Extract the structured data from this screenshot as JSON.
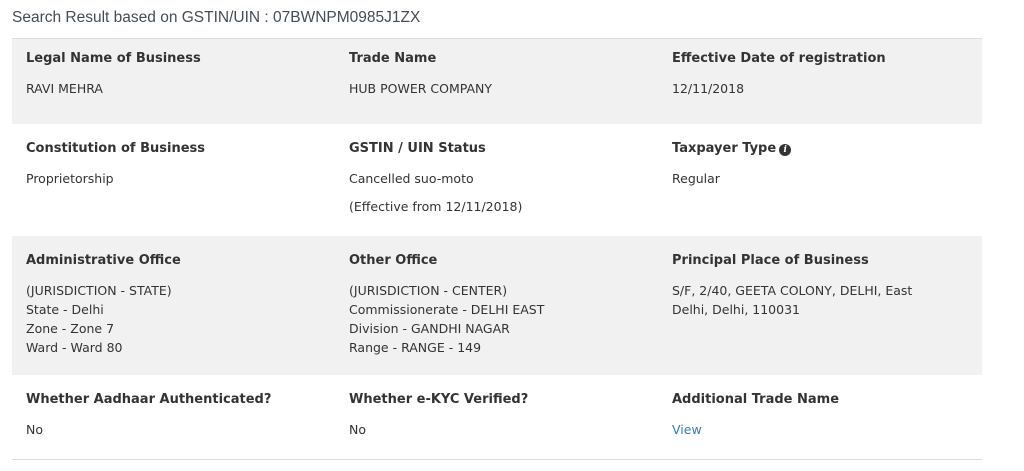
{
  "header": {
    "title": "Search Result based on GSTIN/UIN : 07BWNPM0985J1ZX"
  },
  "rows": [
    {
      "cells": [
        {
          "label": "Legal Name of Business",
          "lines": [
            "RAVI MEHRA"
          ]
        },
        {
          "label": "Trade Name",
          "lines": [
            "HUB POWER COMPANY"
          ]
        },
        {
          "label": "Effective Date of registration",
          "lines": [
            "12/11/2018"
          ]
        }
      ]
    },
    {
      "cells": [
        {
          "label": "Constitution of Business",
          "lines": [
            "Proprietorship"
          ]
        },
        {
          "label": "GSTIN / UIN Status",
          "lines": [
            "Cancelled suo-moto",
            "(Effective from 12/11/2018)"
          ]
        },
        {
          "label": "Taxpayer Type",
          "lines": [
            "Regular"
          ],
          "icon": "info-circle-icon"
        }
      ]
    },
    {
      "cells": [
        {
          "label": "Administrative Office",
          "lines": [
            "(JURISDICTION - STATE)",
            "State - Delhi",
            "Zone - Zone 7",
            "Ward - Ward 80"
          ]
        },
        {
          "label": "Other Office",
          "lines": [
            "(JURISDICTION - CENTER)",
            "Commissionerate - DELHI EAST",
            "Division - GANDHI NAGAR",
            "Range - RANGE - 149"
          ]
        },
        {
          "label": "Principal Place of Business",
          "lines": [
            "S/F, 2/40, GEETA COLONY, DELHI, East",
            "Delhi, Delhi, 110031"
          ]
        }
      ]
    },
    {
      "cells": [
        {
          "label": "Whether Aadhaar Authenticated?",
          "lines": [
            "No"
          ]
        },
        {
          "label": "Whether e-KYC Verified?",
          "lines": [
            "No"
          ]
        },
        {
          "label": "Additional Trade Name",
          "link": "View"
        }
      ]
    }
  ],
  "colors": {
    "row_shade": "#f1f1f1",
    "link": "#2a7fc1",
    "text": "#333333"
  }
}
